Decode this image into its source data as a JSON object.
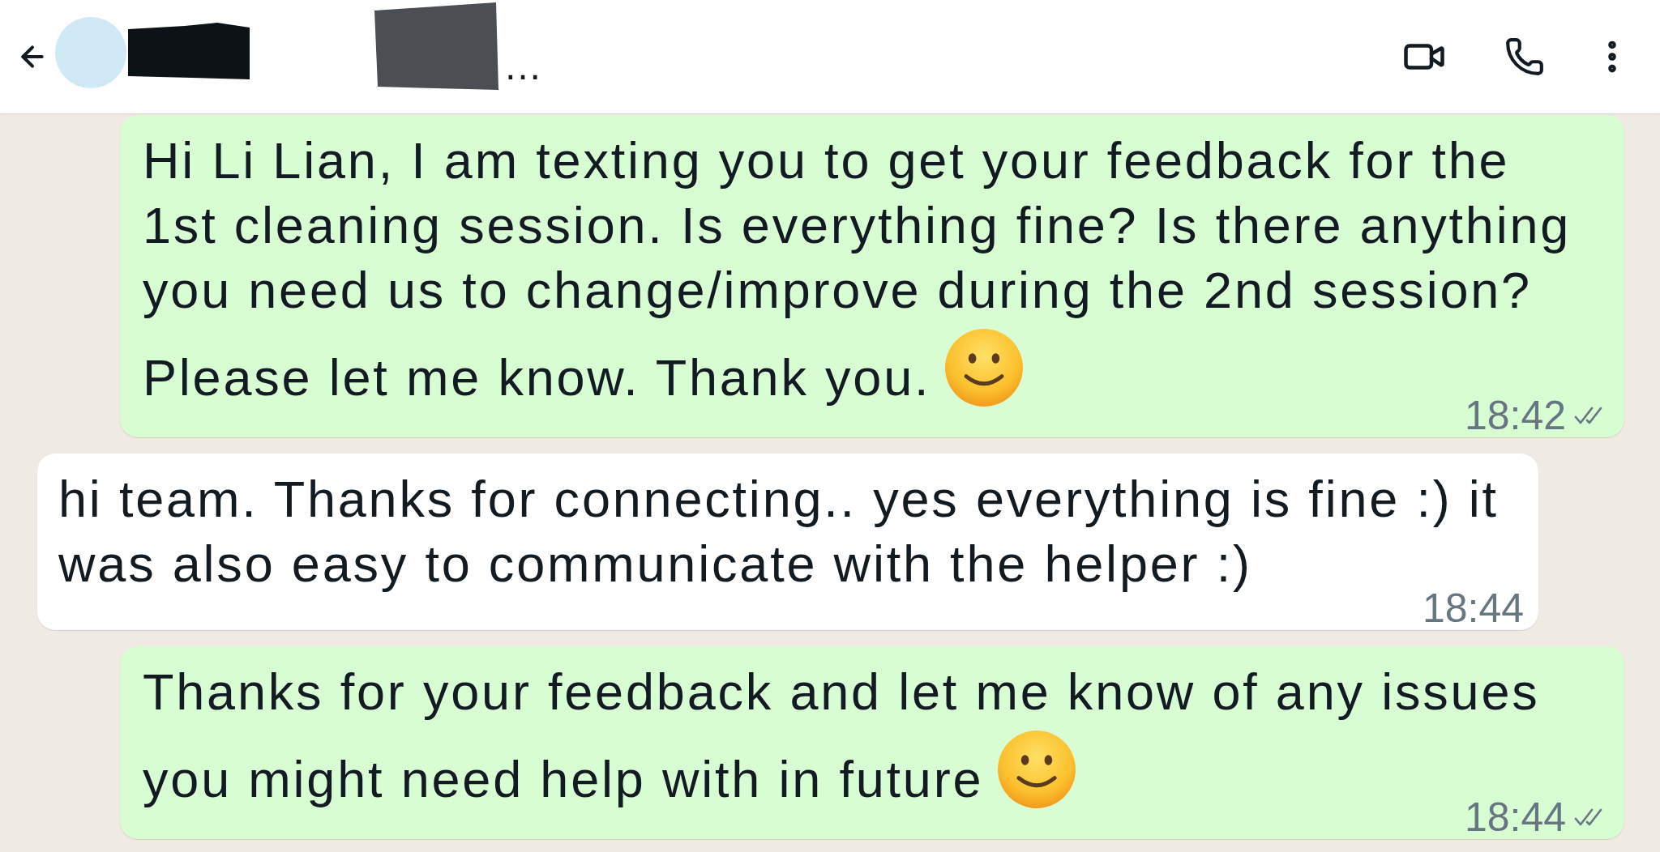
{
  "header": {
    "redacted": true,
    "contact_name": "…",
    "actions": [
      {
        "kind": "video"
      },
      {
        "kind": "call"
      },
      {
        "kind": "menu"
      }
    ]
  },
  "messages": [
    {
      "kind": "outgoing",
      "text": "Hi Li Lian, I am texting you to get your feedback for the 1st cleaning session. Is everything fine? Is there anything you need us to change/improve during the 2nd session? Please let me know. Thank you.",
      "trailing_emoji": true,
      "time": "18:42",
      "delivered": true,
      "read": false
    },
    {
      "kind": "incoming",
      "text": "hi team. Thanks for connecting.. yes everything is fine :) it was also easy to communicate with the helper :)",
      "trailing_emoji": false,
      "time": "18:44"
    },
    {
      "kind": "outgoing",
      "text": "Thanks for your feedback and let me know of any issues you might need help with in future",
      "trailing_emoji": true,
      "time": "18:44",
      "delivered": true,
      "read": false
    }
  ]
}
